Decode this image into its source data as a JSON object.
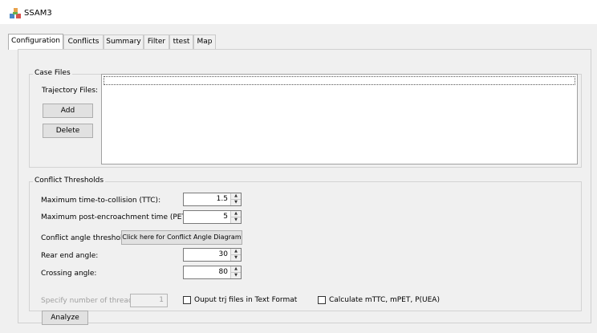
{
  "window": {
    "title": "SSAM3",
    "icon": "app-logo-icon"
  },
  "tabs": [
    {
      "label": "Configuration",
      "active": true
    },
    {
      "label": "Conflicts"
    },
    {
      "label": "Summary"
    },
    {
      "label": "Filter"
    },
    {
      "label": "ttest"
    },
    {
      "label": "Map"
    }
  ],
  "case_files": {
    "legend": "Case Files",
    "trajectory_label": "Trajectory Files:",
    "add_label": "Add",
    "delete_label": "Delete"
  },
  "thresholds": {
    "legend": "Conflict Thresholds",
    "ttc_label": "Maximum time-to-collision (TTC):",
    "ttc_value": "1.5",
    "pet_label": "Maximum post-encroachment time (PET):",
    "pet_value": "5",
    "angle_label": "Conflict angle thresholds:",
    "angle_button": "Click here for Conflict Angle Diagram",
    "rear_label": "Rear end angle:",
    "rear_value": "30",
    "crossing_label": "Crossing angle:",
    "crossing_value": "80"
  },
  "footer": {
    "threads_label": "Specify number of threads:",
    "threads_value": "1",
    "text_format_label": "Ouput trj files in Text Format",
    "calc_label": "Calculate mTTC, mPET, P(UEA)",
    "analyze_label": "Analyze"
  }
}
